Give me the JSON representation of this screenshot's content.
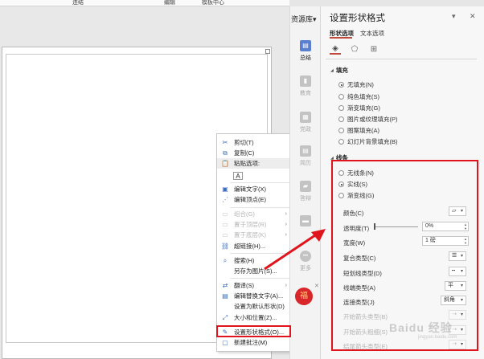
{
  "topbar": {
    "left": "连结",
    "mid1": "编辑",
    "mid2": "模板中心"
  },
  "resource": {
    "title": "资源库",
    "title_caret": "▾",
    "buttons": [
      {
        "label": "总结",
        "glyph": "▤",
        "active": true
      },
      {
        "label": "教育",
        "glyph": "▮",
        "active": false
      },
      {
        "label": "党政",
        "glyph": "▦",
        "active": false
      },
      {
        "label": "简历",
        "glyph": "▤",
        "active": false
      },
      {
        "label": "答辩",
        "glyph": "▰",
        "active": false
      },
      {
        "label": "",
        "glyph": "▬",
        "active": false
      },
      {
        "label": "更多",
        "glyph": "•••",
        "active": false
      }
    ],
    "lucky_glyph": "福",
    "lucky_close": "✕"
  },
  "context_menu": {
    "items": [
      {
        "label": "剪切(T)",
        "icon": "✂",
        "disabled": false,
        "submenu": false
      },
      {
        "label": "复制(C)",
        "icon": "⧉",
        "disabled": false,
        "submenu": false
      },
      {
        "label": "粘贴选项:",
        "icon": "📋",
        "disabled": false,
        "submenu": false,
        "header": true
      },
      {
        "label": "",
        "icon": "A",
        "disabled": false,
        "submenu": false,
        "paste": true
      },
      {
        "label": "编辑文字(X)",
        "icon": "▣",
        "disabled": false,
        "submenu": false
      },
      {
        "label": "编辑顶点(E)",
        "icon": "⋰",
        "disabled": false,
        "submenu": false
      },
      {
        "label": "组合(G)",
        "icon": "▭",
        "disabled": true,
        "submenu": true
      },
      {
        "label": "置于顶层(R)",
        "icon": "▭",
        "disabled": true,
        "submenu": true
      },
      {
        "label": "置于底层(K)",
        "icon": "▭",
        "disabled": true,
        "submenu": true
      },
      {
        "label": "超链接(H)...",
        "icon": "⛓",
        "disabled": false,
        "submenu": false
      },
      {
        "label": "搜索(H)",
        "icon": "⌕",
        "disabled": false,
        "submenu": false
      },
      {
        "label": "另存为图片(S)...",
        "icon": "",
        "disabled": false,
        "submenu": false
      },
      {
        "label": "翻译(S)",
        "icon": "⇄",
        "disabled": false,
        "submenu": true
      },
      {
        "label": "编辑替换文字(A)...",
        "icon": "▤",
        "disabled": false,
        "submenu": false
      },
      {
        "label": "设置为默认形状(D)",
        "icon": "",
        "disabled": false,
        "submenu": false
      },
      {
        "label": "大小和位置(Z)...",
        "icon": "⤢",
        "disabled": false,
        "submenu": false
      },
      {
        "label": "设置形状格式(O)...",
        "icon": "✎",
        "disabled": false,
        "submenu": false
      },
      {
        "label": "新建批注(M)",
        "icon": "▢",
        "disabled": false,
        "submenu": false
      }
    ]
  },
  "panel": {
    "title": "设置形状格式",
    "caret": "▾",
    "close": "✕",
    "tabs": [
      "形状选项",
      "文本选项"
    ],
    "icons": [
      "◈",
      "⬠",
      "⊞"
    ],
    "fill": {
      "heading": "填充",
      "options": [
        {
          "label": "无填充(N)",
          "selected": true
        },
        {
          "label": "纯色填充(S)",
          "selected": false
        },
        {
          "label": "渐变填充(G)",
          "selected": false
        },
        {
          "label": "图片或纹理填充(P)",
          "selected": false
        },
        {
          "label": "图案填充(A)",
          "selected": false
        },
        {
          "label": "幻灯片背景填充(B)",
          "selected": false
        }
      ]
    },
    "line": {
      "heading": "线条",
      "options": [
        {
          "label": "无线条(N)",
          "selected": false
        },
        {
          "label": "实线(S)",
          "selected": true
        },
        {
          "label": "渐变线(G)",
          "selected": false
        }
      ],
      "props": {
        "color": {
          "label": "颜色(C)",
          "value": "▱"
        },
        "transparency": {
          "label": "透明度(T)",
          "value": "0%"
        },
        "width": {
          "label": "宽度(W)",
          "value": "1 磅"
        },
        "compound": {
          "label": "复合类型(C)",
          "value": "☰"
        },
        "dash": {
          "label": "短划线类型(D)",
          "value": "┅"
        },
        "cap": {
          "label": "线端类型(A)",
          "value": "平"
        },
        "join": {
          "label": "连接类型(J)",
          "value": "斜角"
        },
        "begin_type": {
          "label": "开始箭头类型(B)",
          "value": "⇢"
        },
        "begin_size": {
          "label": "开始箭头粗细(S)",
          "value": "⇢"
        },
        "end_type": {
          "label": "结尾箭头类型(E)",
          "value": "⇢"
        }
      }
    }
  },
  "watermark": {
    "text": "Baidu 经验",
    "sub": "jingyan.baidu.com"
  },
  "colors": {
    "accent": "#c04a3b",
    "highlight": "#e0141c",
    "resource_active": "#5b7fcf"
  }
}
